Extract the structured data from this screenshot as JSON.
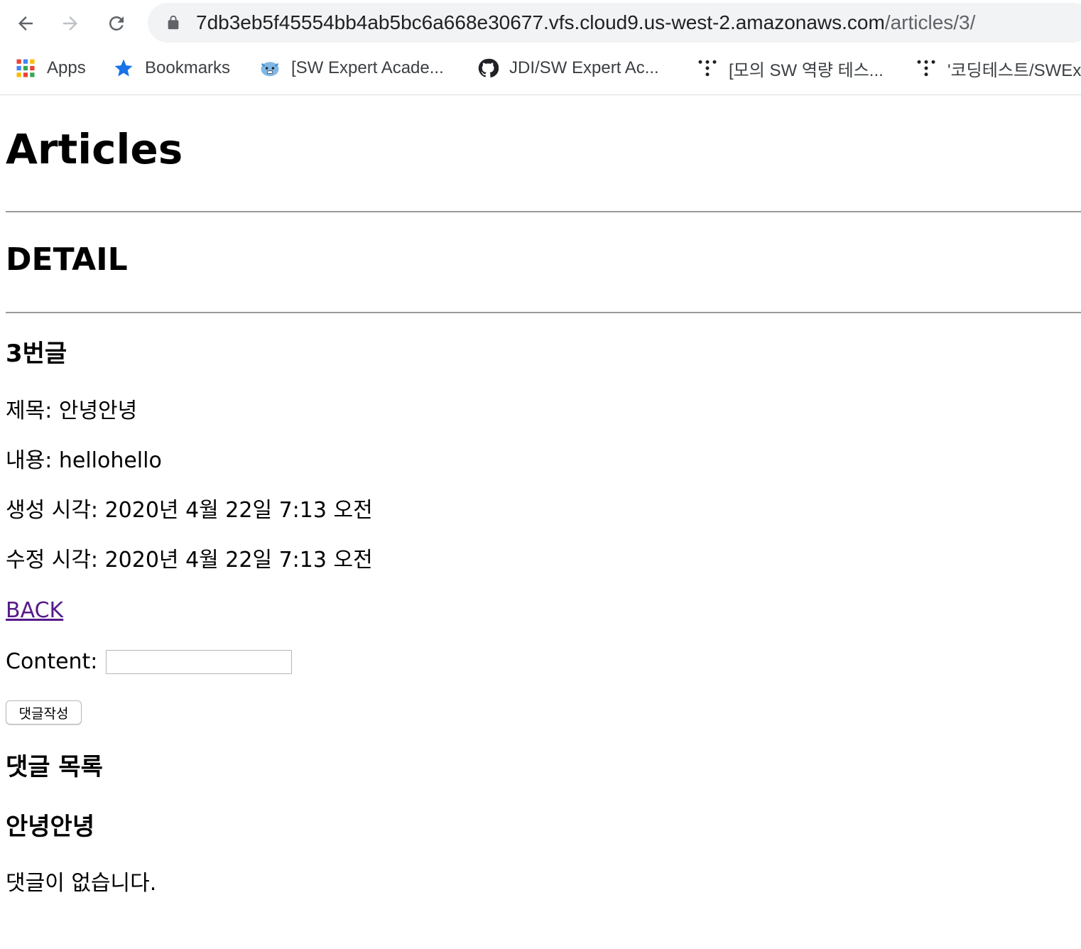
{
  "browser": {
    "url_host": "7db3eb5f45554bb4ab5bc6a668e30677.vfs.cloud9.us-west-2.amazonaws.com",
    "url_path": "/articles/3/",
    "icons": {
      "back": "arrow-left-icon",
      "forward": "arrow-right-icon",
      "reload": "reload-icon",
      "lock": "lock-icon"
    },
    "bookmarks": [
      {
        "label": "Apps",
        "icon": "apps-grid-icon"
      },
      {
        "label": "Bookmarks",
        "icon": "star-icon"
      },
      {
        "label": "[SW Expert Acade...",
        "icon": "sw-expert-academy-icon"
      },
      {
        "label": "JDI/SW Expert Ac...",
        "icon": "github-icon"
      },
      {
        "label": "[모의 SW 역량 테스...",
        "icon": "dots-icon"
      },
      {
        "label": "'코딩테스트/SWEx",
        "icon": "dots-icon"
      }
    ]
  },
  "page": {
    "title": "Articles",
    "section": "DETAIL",
    "article_number": "3번글",
    "fields": {
      "title": "제목: 안녕안녕",
      "content": "내용: hellohello",
      "created": "생성 시각: 2020년 4월 22일 7:13 오전",
      "updated": "수정 시각: 2020년 4월 22일 7:13 오전"
    },
    "back_link": "BACK",
    "comment_form": {
      "label": "Content:",
      "value": "",
      "submit": "댓글작성"
    },
    "comments_heading": "댓글 목록",
    "comment_article_title": "안녕안녕",
    "no_comments": "댓글이 없습니다."
  },
  "colors": {
    "link_visited": "#551a8b",
    "omnibox_bg": "#f1f3f4",
    "star": "#1a73e8"
  }
}
